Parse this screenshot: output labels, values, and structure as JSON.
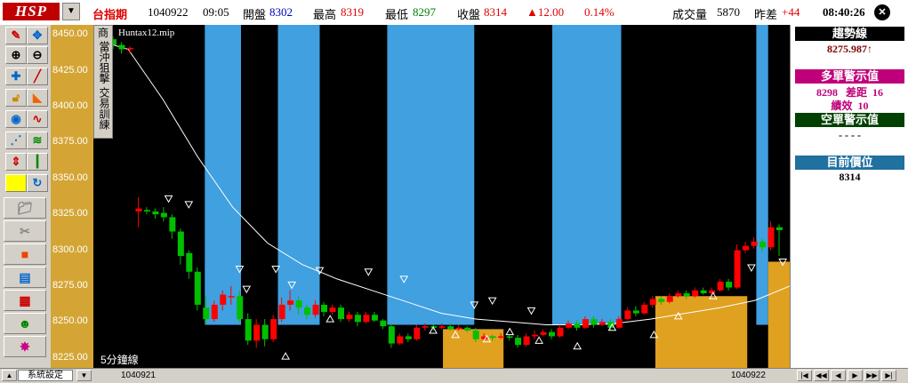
{
  "header": {
    "logo": "HSP",
    "symbol": "台指期",
    "date": "1040922",
    "time": "09:05",
    "open_label": "開盤",
    "open": "8302",
    "high_label": "最高",
    "high": "8319",
    "low_label": "最低",
    "low": "8297",
    "close_label": "收盤",
    "close": "8314",
    "change": "▲12.00",
    "change_pct": "0.14%",
    "volume_label": "成交量",
    "volume": "5870",
    "diff_label": "昨差",
    "diff": "+44",
    "clock": "08:40:26"
  },
  "toolbar_icons": [
    "pencil-icon",
    "cross-cursor-icon",
    "zoom-in-icon",
    "zoom-out-icon",
    "crosshair-icon",
    "line-draw-icon",
    "lock-icon",
    "ruler-icon",
    "target-icon",
    "wave-icon",
    "fan-icon",
    "zigzag-icon",
    "up-down-icon",
    "candle-icon",
    "square-icon",
    "refresh-icon",
    "folder-icon",
    "scissors-icon",
    "stop-icon",
    "chart-icon",
    "grid-icon",
    "user-icon",
    "burst-icon"
  ],
  "menu": {
    "items": [
      "商",
      "當沖狙擊",
      "交易訓練"
    ]
  },
  "indicator_name": "Huntax12.mip",
  "period_label": "5分鐘線",
  "y_axis": {
    "ticks": [
      "8450.00",
      "8425.00",
      "8400.00",
      "8375.00",
      "8350.00",
      "8325.00",
      "8300.00",
      "8275.00",
      "8250.00",
      "8225.00"
    ]
  },
  "right_panel": {
    "trend_label": "趨勢線",
    "trend_value": "8275.987↑",
    "long_label": "多單警示值",
    "long_value": "8298",
    "long_diff_label": "差距",
    "long_diff": "16",
    "perf_label": "績效",
    "perf": "10",
    "short_label": "空單警示值",
    "short_value": "- - - -",
    "position_label": "目前價位",
    "position_value": "8314"
  },
  "bottom": {
    "system_settings": "系統設定",
    "date_left": "1040921",
    "date_right": "1040922"
  },
  "colors": {
    "up": "#ff0000",
    "down": "#00c000",
    "band_blue": "#40a0e0",
    "band_orange": "#e0a020",
    "axis_bg": "#d4a535"
  },
  "chart_data": {
    "type": "candlestick",
    "y_range": [
      8218,
      8457
    ],
    "bands_blue": [
      [
        0.16,
        0.212
      ],
      [
        0.265,
        0.325
      ],
      [
        0.422,
        0.547
      ],
      [
        0.659,
        0.758
      ],
      [
        0.952,
        0.969
      ]
    ],
    "bands_orange": [
      [
        0.502,
        0.589
      ],
      [
        0.807,
        0.939
      ],
      [
        0.969,
        1.0
      ]
    ],
    "candles": [
      {
        "o": 8447,
        "c": 8443,
        "h": 8449,
        "l": 8440,
        "t": "d"
      },
      {
        "o": 8443,
        "c": 8440,
        "h": 8445,
        "l": 8437,
        "t": "d"
      },
      {
        "o": 8440,
        "c": 8441,
        "h": 8442,
        "l": 8437,
        "t": "u"
      },
      {
        "o": 8327,
        "c": 8329,
        "h": 8337,
        "l": 8316,
        "t": "u"
      },
      {
        "o": 8328,
        "c": 8327,
        "h": 8330,
        "l": 8325,
        "t": "d"
      },
      {
        "o": 8327,
        "c": 8325,
        "h": 8329,
        "l": 8322,
        "t": "d"
      },
      {
        "o": 8326,
        "c": 8323,
        "h": 8330,
        "l": 8320,
        "t": "d"
      },
      {
        "o": 8323,
        "c": 8313,
        "h": 8325,
        "l": 8308,
        "t": "d"
      },
      {
        "o": 8313,
        "c": 8296,
        "h": 8315,
        "l": 8290,
        "t": "d"
      },
      {
        "o": 8298,
        "c": 8285,
        "h": 8300,
        "l": 8280,
        "t": "d"
      },
      {
        "o": 8285,
        "c": 8262,
        "h": 8288,
        "l": 8258,
        "t": "d"
      },
      {
        "o": 8260,
        "c": 8252,
        "h": 8268,
        "l": 8248,
        "t": "d"
      },
      {
        "o": 8252,
        "c": 8262,
        "h": 8265,
        "l": 8250,
        "t": "u"
      },
      {
        "o": 8262,
        "c": 8269,
        "h": 8272,
        "l": 8258,
        "t": "u"
      },
      {
        "o": 8268,
        "c": 8268,
        "h": 8275,
        "l": 8262,
        "t": "u"
      },
      {
        "o": 8268,
        "c": 8252,
        "h": 8272,
        "l": 8250,
        "t": "d"
      },
      {
        "o": 8252,
        "c": 8237,
        "h": 8256,
        "l": 8234,
        "t": "d"
      },
      {
        "o": 8237,
        "c": 8248,
        "h": 8252,
        "l": 8232,
        "t": "u"
      },
      {
        "o": 8248,
        "c": 8238,
        "h": 8252,
        "l": 8233,
        "t": "d"
      },
      {
        "o": 8238,
        "c": 8252,
        "h": 8255,
        "l": 8236,
        "t": "u"
      },
      {
        "o": 8252,
        "c": 8262,
        "h": 8267,
        "l": 8250,
        "t": "u"
      },
      {
        "o": 8262,
        "c": 8265,
        "h": 8272,
        "l": 8258,
        "t": "u"
      },
      {
        "o": 8265,
        "c": 8260,
        "h": 8268,
        "l": 8255,
        "t": "d"
      },
      {
        "o": 8260,
        "c": 8255,
        "h": 8262,
        "l": 8252,
        "t": "d"
      },
      {
        "o": 8255,
        "c": 8262,
        "h": 8265,
        "l": 8253,
        "t": "u"
      },
      {
        "o": 8262,
        "c": 8257,
        "h": 8264,
        "l": 8254,
        "t": "d"
      },
      {
        "o": 8257,
        "c": 8260,
        "h": 8262,
        "l": 8255,
        "t": "u"
      },
      {
        "o": 8260,
        "c": 8252,
        "h": 8262,
        "l": 8250,
        "t": "d"
      },
      {
        "o": 8252,
        "c": 8255,
        "h": 8257,
        "l": 8250,
        "t": "u"
      },
      {
        "o": 8255,
        "c": 8250,
        "h": 8257,
        "l": 8247,
        "t": "d"
      },
      {
        "o": 8250,
        "c": 8255,
        "h": 8257,
        "l": 8249,
        "t": "u"
      },
      {
        "o": 8255,
        "c": 8251,
        "h": 8257,
        "l": 8250,
        "t": "d"
      },
      {
        "o": 8251,
        "c": 8247,
        "h": 8252,
        "l": 8245,
        "t": "d"
      },
      {
        "o": 8247,
        "c": 8235,
        "h": 8249,
        "l": 8232,
        "t": "d"
      },
      {
        "o": 8235,
        "c": 8240,
        "h": 8242,
        "l": 8234,
        "t": "u"
      },
      {
        "o": 8240,
        "c": 8238,
        "h": 8242,
        "l": 8236,
        "t": "d"
      },
      {
        "o": 8238,
        "c": 8246,
        "h": 8248,
        "l": 8237,
        "t": "u"
      },
      {
        "o": 8246,
        "c": 8247,
        "h": 8249,
        "l": 8244,
        "t": "u"
      },
      {
        "o": 8247,
        "c": 8246,
        "h": 8248,
        "l": 8244,
        "t": "d"
      },
      {
        "o": 8246,
        "c": 8247,
        "h": 8249,
        "l": 8245,
        "t": "u"
      },
      {
        "o": 8247,
        "c": 8245,
        "h": 8249,
        "l": 8244,
        "t": "d"
      },
      {
        "o": 8245,
        "c": 8246,
        "h": 8248,
        "l": 8244,
        "t": "u"
      },
      {
        "o": 8246,
        "c": 8244,
        "h": 8247,
        "l": 8243,
        "t": "d"
      },
      {
        "o": 8244,
        "c": 8238,
        "h": 8246,
        "l": 8236,
        "t": "d"
      },
      {
        "o": 8238,
        "c": 8240,
        "h": 8242,
        "l": 8236,
        "t": "u"
      },
      {
        "o": 8240,
        "c": 8239,
        "h": 8241,
        "l": 8237,
        "t": "d"
      },
      {
        "o": 8239,
        "c": 8240,
        "h": 8242,
        "l": 8238,
        "t": "u"
      },
      {
        "o": 8240,
        "c": 8239,
        "h": 8241,
        "l": 8237,
        "t": "d"
      },
      {
        "o": 8239,
        "c": 8234,
        "h": 8241,
        "l": 8232,
        "t": "d"
      },
      {
        "o": 8234,
        "c": 8240,
        "h": 8242,
        "l": 8233,
        "t": "u"
      },
      {
        "o": 8240,
        "c": 8241,
        "h": 8244,
        "l": 8238,
        "t": "u"
      },
      {
        "o": 8241,
        "c": 8243,
        "h": 8245,
        "l": 8240,
        "t": "u"
      },
      {
        "o": 8243,
        "c": 8240,
        "h": 8245,
        "l": 8238,
        "t": "d"
      },
      {
        "o": 8240,
        "c": 8246,
        "h": 8248,
        "l": 8239,
        "t": "u"
      },
      {
        "o": 8246,
        "c": 8249,
        "h": 8251,
        "l": 8245,
        "t": "u"
      },
      {
        "o": 8249,
        "c": 8246,
        "h": 8251,
        "l": 8244,
        "t": "d"
      },
      {
        "o": 8246,
        "c": 8252,
        "h": 8254,
        "l": 8245,
        "t": "u"
      },
      {
        "o": 8252,
        "c": 8248,
        "h": 8254,
        "l": 8246,
        "t": "d"
      },
      {
        "o": 8248,
        "c": 8250,
        "h": 8252,
        "l": 8247,
        "t": "u"
      },
      {
        "o": 8250,
        "c": 8246,
        "h": 8252,
        "l": 8244,
        "t": "d"
      },
      {
        "o": 8246,
        "c": 8252,
        "h": 8254,
        "l": 8245,
        "t": "u"
      },
      {
        "o": 8252,
        "c": 8258,
        "h": 8260,
        "l": 8251,
        "t": "u"
      },
      {
        "o": 8258,
        "c": 8256,
        "h": 8261,
        "l": 8254,
        "t": "d"
      },
      {
        "o": 8256,
        "c": 8262,
        "h": 8264,
        "l": 8255,
        "t": "u"
      },
      {
        "o": 8262,
        "c": 8266,
        "h": 8268,
        "l": 8260,
        "t": "u"
      },
      {
        "o": 8266,
        "c": 8264,
        "h": 8268,
        "l": 8262,
        "t": "d"
      },
      {
        "o": 8264,
        "c": 8268,
        "h": 8270,
        "l": 8263,
        "t": "u"
      },
      {
        "o": 8268,
        "c": 8270,
        "h": 8272,
        "l": 8267,
        "t": "u"
      },
      {
        "o": 8270,
        "c": 8268,
        "h": 8272,
        "l": 8266,
        "t": "d"
      },
      {
        "o": 8268,
        "c": 8272,
        "h": 8274,
        "l": 8267,
        "t": "u"
      },
      {
        "o": 8272,
        "c": 8270,
        "h": 8274,
        "l": 8269,
        "t": "d"
      },
      {
        "o": 8270,
        "c": 8272,
        "h": 8274,
        "l": 8269,
        "t": "u"
      },
      {
        "o": 8272,
        "c": 8278,
        "h": 8280,
        "l": 8271,
        "t": "u"
      },
      {
        "o": 8278,
        "c": 8274,
        "h": 8280,
        "l": 8272,
        "t": "d"
      },
      {
        "o": 8274,
        "c": 8300,
        "h": 8304,
        "l": 8273,
        "t": "u"
      },
      {
        "o": 8300,
        "c": 8303,
        "h": 8306,
        "l": 8298,
        "t": "u"
      },
      {
        "o": 8303,
        "c": 8306,
        "h": 8309,
        "l": 8301,
        "t": "u"
      },
      {
        "o": 8306,
        "c": 8302,
        "h": 8308,
        "l": 8299,
        "t": "d"
      },
      {
        "o": 8302,
        "c": 8316,
        "h": 8320,
        "l": 8300,
        "t": "u"
      },
      {
        "o": 8316,
        "c": 8314,
        "h": 8318,
        "l": 8296,
        "t": "d"
      }
    ],
    "trend_line": [
      [
        0,
        8447
      ],
      [
        0.05,
        8440
      ],
      [
        0.1,
        8405
      ],
      [
        0.15,
        8365
      ],
      [
        0.2,
        8330
      ],
      [
        0.25,
        8305
      ],
      [
        0.3,
        8290
      ],
      [
        0.35,
        8280
      ],
      [
        0.4,
        8272
      ],
      [
        0.45,
        8264
      ],
      [
        0.5,
        8256
      ],
      [
        0.55,
        8252
      ],
      [
        0.6,
        8250
      ],
      [
        0.65,
        8248
      ],
      [
        0.7,
        8248
      ],
      [
        0.75,
        8249
      ],
      [
        0.8,
        8252
      ],
      [
        0.85,
        8256
      ],
      [
        0.9,
        8260
      ],
      [
        0.95,
        8265
      ],
      [
        1.0,
        8275
      ]
    ],
    "markers_down": [
      [
        0.108,
        8336
      ],
      [
        0.137,
        8332
      ],
      [
        0.21,
        8287
      ],
      [
        0.22,
        8273
      ],
      [
        0.262,
        8287
      ],
      [
        0.285,
        8276
      ],
      [
        0.325,
        8286
      ],
      [
        0.395,
        8285
      ],
      [
        0.446,
        8280
      ],
      [
        0.547,
        8262
      ],
      [
        0.573,
        8265
      ],
      [
        0.629,
        8258
      ],
      [
        0.945,
        8288
      ],
      [
        0.99,
        8292
      ]
    ],
    "markers_up": [
      [
        0.276,
        8226
      ],
      [
        0.34,
        8252
      ],
      [
        0.488,
        8244
      ],
      [
        0.52,
        8241
      ],
      [
        0.565,
        8238
      ],
      [
        0.598,
        8243
      ],
      [
        0.64,
        8237
      ],
      [
        0.695,
        8233
      ],
      [
        0.745,
        8246
      ],
      [
        0.805,
        8241
      ],
      [
        0.84,
        8254
      ],
      [
        0.89,
        8268
      ]
    ]
  }
}
